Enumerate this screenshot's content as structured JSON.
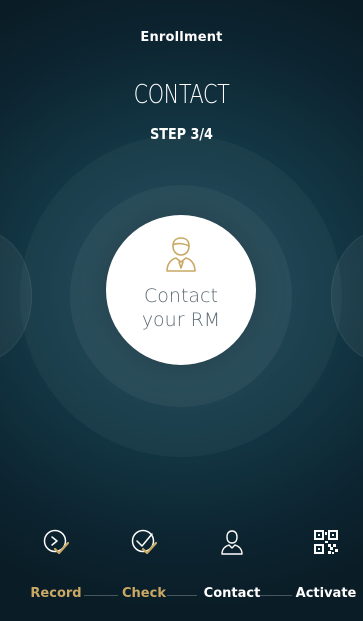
{
  "header": {
    "title": "Enrollment"
  },
  "step_heading": {
    "title": "CONTACT",
    "subtitle": "STEP 3/4"
  },
  "main_action": {
    "line1": "Contact",
    "line2": "your RM",
    "icon": "person-icon"
  },
  "stepper": {
    "steps": [
      {
        "label": "Record",
        "icon": "record-icon",
        "state": "done"
      },
      {
        "label": "Check",
        "icon": "check-icon",
        "state": "done"
      },
      {
        "label": "Contact",
        "icon": "person-icon",
        "state": "current"
      },
      {
        "label": "Activate",
        "icon": "qr-code-icon",
        "state": "todo"
      }
    ]
  },
  "colors": {
    "accent_gold": "#c9a964",
    "background_dark": "#0c2430",
    "circle_text": "#5b6b72"
  }
}
